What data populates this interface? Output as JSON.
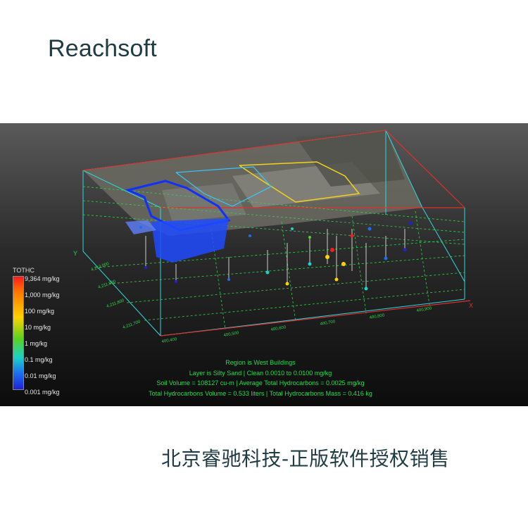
{
  "brand": "Reachsoft",
  "legend": {
    "title": "TOTHC",
    "items": [
      "9,364 mg/kg",
      "1,000 mg/kg",
      "100 mg/kg",
      "10 mg/kg",
      "1 mg/kg",
      "0.1 mg/kg",
      "0.01 mg/kg",
      "0.001 mg/kg"
    ]
  },
  "axes": {
    "y_label": "Y",
    "x_label": "X"
  },
  "info": {
    "region": "Region is West Buildings",
    "layer": "Layer is Silty Sand  |  Clean  0.0010 to 0.0100 mg/kg",
    "soil": "Soil Volume = 108127 cu-m  |  Average Total Hydrocarbons = 0.0025 mg/kg",
    "totals": "Total Hydrocarbons Volume = 0.533 liters  |  Total Hydrocarbons Mass = 0.416 kg"
  },
  "caption": "北京睿驰科技-正版软件授权销售",
  "colors": {
    "title": "#1f3b44",
    "info_text": "#19e24b",
    "box_cyan": "#2fd8e0",
    "box_red": "#e0302a",
    "plume_blue": "#1030ff"
  }
}
